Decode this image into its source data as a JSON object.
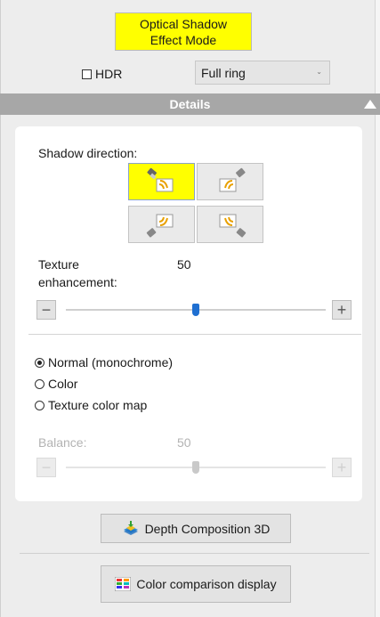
{
  "mode_button": {
    "label": "Optical Shadow Effect Mode",
    "color": "#ffff00"
  },
  "hdr": {
    "label": "HDR",
    "checked": false
  },
  "ring_select": {
    "value": "Full ring"
  },
  "details_bar": {
    "label": "Details"
  },
  "shadow_direction": {
    "label": "Shadow direction:",
    "buttons": [
      {
        "name": "top-left",
        "active": true
      },
      {
        "name": "top-right",
        "active": false
      },
      {
        "name": "bottom-left",
        "active": false
      },
      {
        "name": "bottom-right",
        "active": false
      }
    ]
  },
  "texture": {
    "label_line1": "Texture",
    "label_line2": "enhancement:",
    "value": "50",
    "level": 50,
    "min_label": "−",
    "plus_label": "+"
  },
  "color_modes": {
    "options": [
      "Normal (monochrome)",
      "Color",
      "Texture color map"
    ],
    "selected": 0
  },
  "balance": {
    "label": "Balance:",
    "value": "50",
    "level": 50,
    "enabled": false,
    "min_label": "−",
    "plus_label": "+"
  },
  "depth_button": {
    "label": "Depth Composition  3D"
  },
  "compare_button": {
    "label": "Color comparison display"
  }
}
